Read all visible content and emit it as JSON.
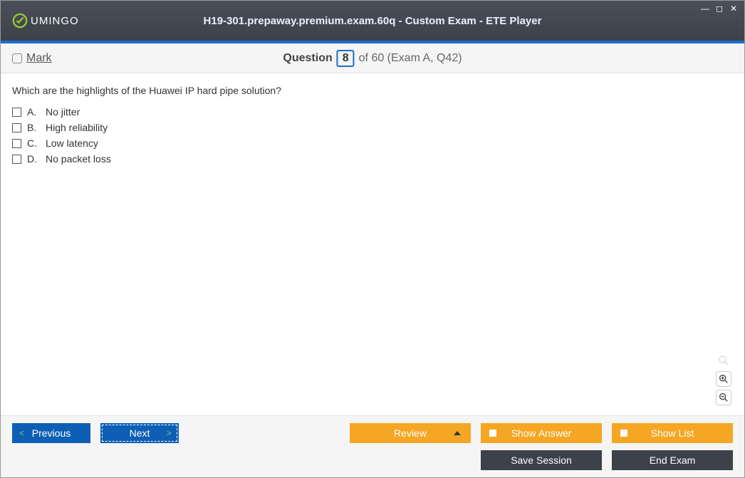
{
  "titlebar": {
    "logo_text": "UMINGO",
    "title": "H19-301.prepaway.premium.exam.60q - Custom Exam - ETE Player"
  },
  "header": {
    "mark_label": "Mark",
    "question_label": "Question",
    "question_number": "8",
    "question_suffix": "of 60 (Exam A, Q42)"
  },
  "question": {
    "text": "Which are the highlights of the Huawei IP hard pipe solution?",
    "choices": [
      {
        "letter": "A.",
        "text": "No jitter"
      },
      {
        "letter": "B.",
        "text": "High reliability"
      },
      {
        "letter": "C.",
        "text": "Low latency"
      },
      {
        "letter": "D.",
        "text": "No packet loss"
      }
    ]
  },
  "footer": {
    "previous": "Previous",
    "next": "Next",
    "review": "Review",
    "show_answer": "Show Answer",
    "show_list": "Show List",
    "save_session": "Save Session",
    "end_exam": "End Exam"
  }
}
